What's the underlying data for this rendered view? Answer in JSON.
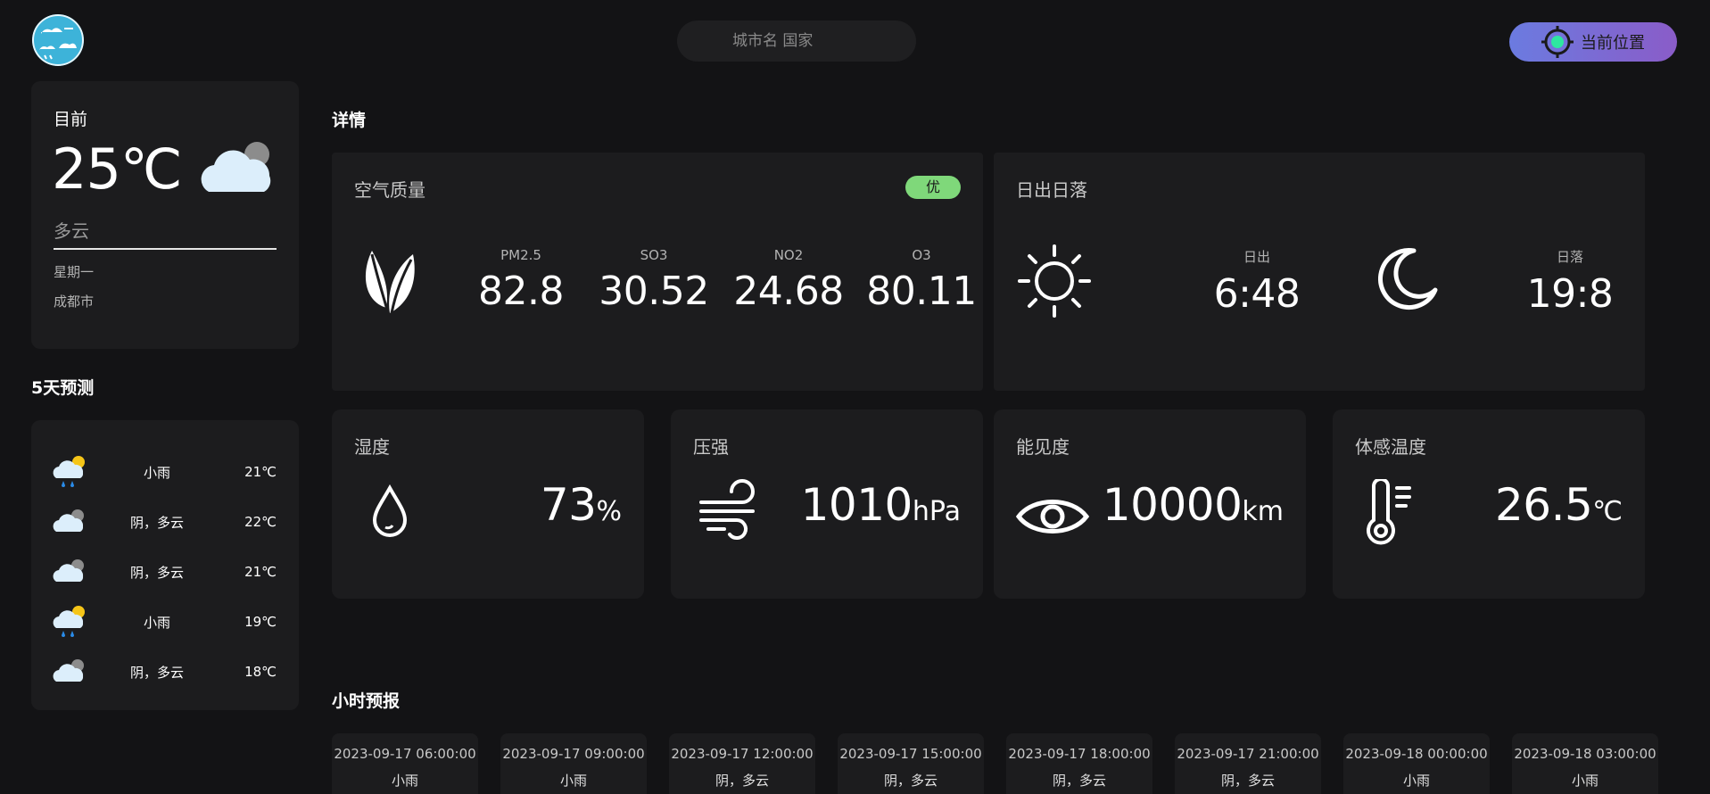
{
  "header": {
    "logo_icon": "weather-logo-icon",
    "search": {
      "placeholder": "城市名 国家",
      "value": ""
    },
    "location_button": {
      "label": "当前位置",
      "icon": "crosshair-icon"
    }
  },
  "current": {
    "title": "目前",
    "temperature": "25℃",
    "condition": "多云",
    "weekday": "星期一",
    "city": "成都市",
    "icon": "cloudy-icon"
  },
  "forecast": {
    "title": "5天预测",
    "items": [
      {
        "icon": "light-rain-icon",
        "condition": "小雨",
        "temp": "21℃"
      },
      {
        "icon": "cloudy-icon",
        "condition": "阴，多云",
        "temp": "22℃"
      },
      {
        "icon": "cloudy-icon",
        "condition": "阴，多云",
        "temp": "21℃"
      },
      {
        "icon": "light-rain-icon",
        "condition": "小雨",
        "temp": "19℃"
      },
      {
        "icon": "cloudy-icon",
        "condition": "阴，多云",
        "temp": "18℃"
      }
    ]
  },
  "details": {
    "title": "详情",
    "air_quality": {
      "title": "空气质量",
      "badge": "优",
      "badge_color": "#7fd87a",
      "pollutants": [
        {
          "name": "PM2.5",
          "value": "82.8"
        },
        {
          "name": "SO3",
          "value": "30.52"
        },
        {
          "name": "NO2",
          "value": "24.68"
        },
        {
          "name": "O3",
          "value": "80.11"
        }
      ]
    },
    "sun": {
      "title": "日出日落",
      "sunrise_label": "日出",
      "sunrise": "6:48",
      "sunset_label": "日落",
      "sunset": "19:8"
    },
    "humidity": {
      "title": "湿度",
      "value": "73",
      "unit": "%"
    },
    "pressure": {
      "title": "压强",
      "value": "1010",
      "unit": "hPa"
    },
    "visibility": {
      "title": "能见度",
      "value": "10000",
      "unit": "km"
    },
    "feels_like": {
      "title": "体感温度",
      "value": "26.5",
      "unit": "℃"
    }
  },
  "hourly": {
    "title": "小时预报",
    "items": [
      {
        "time": "2023-09-17 06:00:00",
        "condition": "小雨"
      },
      {
        "time": "2023-09-17 09:00:00",
        "condition": "小雨"
      },
      {
        "time": "2023-09-17 12:00:00",
        "condition": "阴，多云"
      },
      {
        "time": "2023-09-17 15:00:00",
        "condition": "阴，多云"
      },
      {
        "time": "2023-09-17 18:00:00",
        "condition": "阴，多云"
      },
      {
        "time": "2023-09-17 21:00:00",
        "condition": "阴，多云"
      },
      {
        "time": "2023-09-18 00:00:00",
        "condition": "小雨"
      },
      {
        "time": "2023-09-18 03:00:00",
        "condition": "小雨"
      }
    ]
  },
  "colors": {
    "background": "#131315",
    "card": "#1c1c1e",
    "accent_gradient_start": "#6b7be0",
    "accent_gradient_end": "#8a5cc8",
    "crosshair_dot": "#2ee6a0"
  }
}
